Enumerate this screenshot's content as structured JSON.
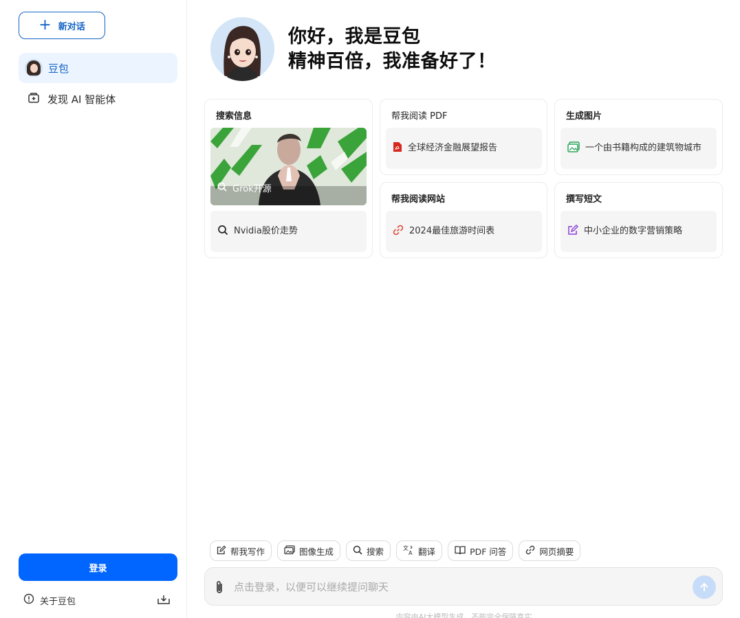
{
  "sidebar": {
    "new_chat_label": "新对话",
    "items": [
      {
        "label": "豆包",
        "active": true,
        "icon": "doubao-avatar"
      },
      {
        "label": "发现 AI 智能体",
        "active": false,
        "icon": "agent-store-icon"
      }
    ],
    "login_label": "登录",
    "about_label": "关于豆包"
  },
  "hero": {
    "line1": "你好，我是豆包",
    "line2": "精神百倍，我准备好了！"
  },
  "cards": {
    "search": {
      "title": "搜索信息",
      "image_chip_label": "Grok开源",
      "chip_label": "Nvidia股价走势"
    },
    "read_pdf": {
      "title": "帮我阅读 PDF",
      "chip_label": "全球经济金融展望报告"
    },
    "gen_image": {
      "title": "生成图片",
      "chip_label": "一个由书籍构成的建筑物城市"
    },
    "read_web": {
      "title": "帮我阅读网站",
      "chip_label": "2024最佳旅游时间表"
    },
    "write": {
      "title": "撰写短文",
      "chip_label": "中小企业的数字营销策略"
    }
  },
  "toolbar": [
    {
      "label": "帮我写作",
      "icon": "edit-icon"
    },
    {
      "label": "图像生成",
      "icon": "image-icon"
    },
    {
      "label": "搜索",
      "icon": "search-icon"
    },
    {
      "label": "翻译",
      "icon": "translate-icon"
    },
    {
      "label": "PDF 问答",
      "icon": "book-icon"
    },
    {
      "label": "网页摘要",
      "icon": "link-icon"
    }
  ],
  "input": {
    "placeholder": "点击登录，以便可以继续提问聊天"
  },
  "footer": {
    "disclaimer": "内容由AI大模型生成，不能完全保障真实"
  },
  "colors": {
    "accent": "#0066ff",
    "active_bg": "#ebf4ff",
    "brand_text": "#1463c5",
    "pdf_red": "#d6281e",
    "image_green": "#2aa55a",
    "link_red": "#e0503f",
    "write_purple": "#8b3fd6"
  }
}
